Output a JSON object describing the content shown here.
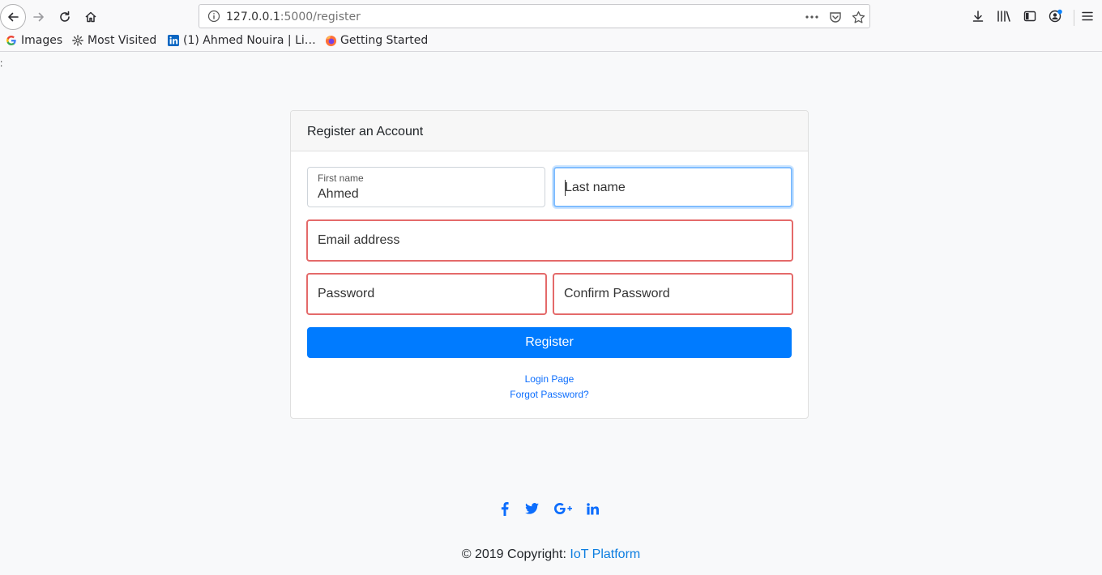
{
  "browser": {
    "url_host": "127.0.0.1",
    "url_path": ":5000/register",
    "bookmarks": [
      {
        "label": "Images",
        "icon": "google-icon"
      },
      {
        "label": "Most Visited",
        "icon": "gear-icon"
      },
      {
        "label": "(1) Ahmed Nouira | Li…",
        "icon": "linkedin-icon"
      },
      {
        "label": "Getting Started",
        "icon": "firefox-icon"
      }
    ]
  },
  "stray_text": ":",
  "card": {
    "title": "Register an Account",
    "first_name": {
      "label": "First name",
      "value": "Ahmed"
    },
    "last_name": {
      "placeholder": "Last name"
    },
    "email": {
      "placeholder": "Email address"
    },
    "password": {
      "placeholder": "Password"
    },
    "confirm_password": {
      "placeholder": "Confirm Password"
    },
    "register_label": "Register",
    "login_link": "Login Page",
    "forgot_link": "Forgot Password?"
  },
  "social": [
    "facebook-icon",
    "twitter-icon",
    "google-plus-icon",
    "linkedin-icon"
  ],
  "footer": {
    "copyright": "© 2019 Copyright: ",
    "brand": "IoT Platform"
  },
  "colors": {
    "primary": "#007bff",
    "invalid_border": "#e46a6a",
    "focus_border": "#80bdff",
    "link": "#0d6efd"
  }
}
